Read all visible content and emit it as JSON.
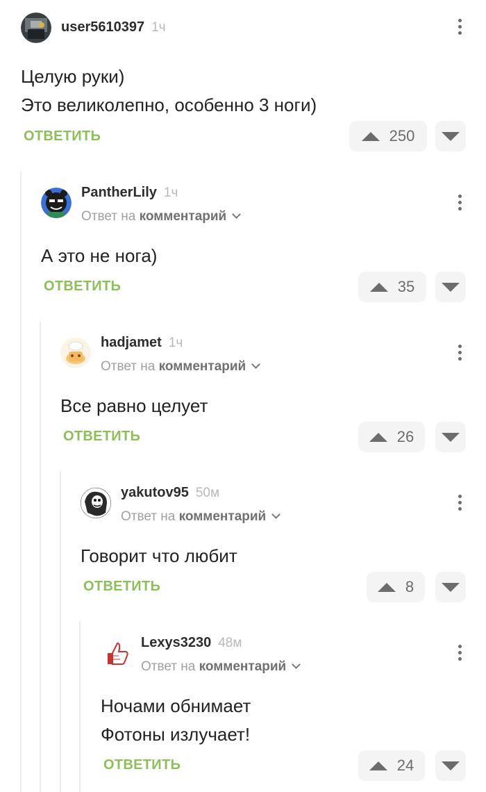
{
  "comments": [
    {
      "username": "user5610397",
      "time": "1ч",
      "reply_prefix": "",
      "reply_target": "",
      "text_lines": [
        "Целую руки)",
        "Это великолепно, особенно 3 ноги)"
      ],
      "reply_label": "ОТВЕТИТЬ",
      "votes": "250"
    },
    {
      "username": "PantherLily",
      "time": "1ч",
      "reply_prefix": "Ответ на",
      "reply_target": "комментарий",
      "text_lines": [
        "А это не нога)"
      ],
      "reply_label": "ОТВЕТИТЬ",
      "votes": "35"
    },
    {
      "username": "hadjamet",
      "time": "1ч",
      "reply_prefix": "Ответ на",
      "reply_target": "комментарий",
      "text_lines": [
        "Все равно целует"
      ],
      "reply_label": "ОТВЕТИТЬ",
      "votes": "26"
    },
    {
      "username": "yakutov95",
      "time": "50м",
      "reply_prefix": "Ответ на",
      "reply_target": "комментарий",
      "text_lines": [
        "Говорит что любит"
      ],
      "reply_label": "ОТВЕТИТЬ",
      "votes": "8"
    },
    {
      "username": "Lexys3230",
      "time": "48м",
      "reply_prefix": "Ответ на",
      "reply_target": "комментарий",
      "text_lines": [
        "Ночами обнимает",
        "Фотоны излучает!"
      ],
      "reply_label": "ОТВЕТИТЬ",
      "votes": "24"
    }
  ],
  "icons": {
    "more": "more-vertical-icon",
    "upvote": "arrow-up-icon",
    "downvote": "arrow-down-icon",
    "reply_chevron": "chevron-down-icon"
  },
  "colors": {
    "reply_action": "#8cbf59",
    "vote_bg": "#f4f4f4",
    "thread_line": "#ececec"
  }
}
